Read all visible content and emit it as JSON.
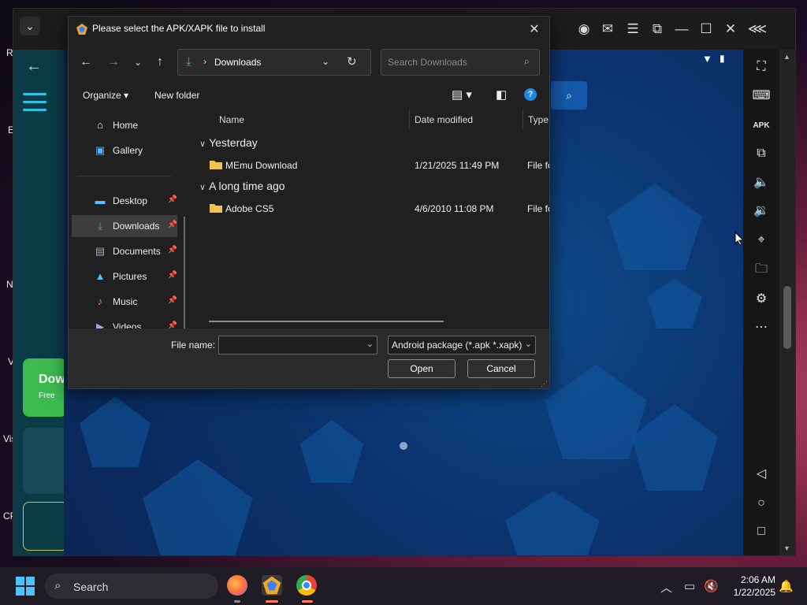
{
  "dialog": {
    "title": "Please select the APK/XAPK file to install",
    "location": "Downloads",
    "search_placeholder": "Search Downloads",
    "organize_label": "Organize",
    "new_folder_label": "New folder",
    "nav_items": [
      {
        "label": "Home",
        "pinned": false
      },
      {
        "label": "Gallery",
        "pinned": false
      },
      {
        "label": "Desktop",
        "pinned": true
      },
      {
        "label": "Downloads",
        "pinned": true,
        "selected": true
      },
      {
        "label": "Documents",
        "pinned": true
      },
      {
        "label": "Pictures",
        "pinned": true
      },
      {
        "label": "Music",
        "pinned": true
      },
      {
        "label": "Videos",
        "pinned": true
      }
    ],
    "columns": {
      "name": "Name",
      "date": "Date modified",
      "type": "Type"
    },
    "groups": [
      {
        "label": "Yesterday",
        "files": [
          {
            "name": "MEmu Download",
            "date": "1/21/2025 11:49 PM",
            "type": "File fo"
          }
        ]
      },
      {
        "label": "A long time ago",
        "files": [
          {
            "name": "Adobe CS5",
            "date": "4/6/2010 11:08 PM",
            "type": "File fo"
          }
        ]
      }
    ],
    "file_name_label": "File name:",
    "file_name_value": "",
    "file_type": "Android package (*.apk *.xapk)",
    "open_label": "Open",
    "cancel_label": "Cancel"
  },
  "emulator": {
    "tools": [
      "fullscreen-icon",
      "keyboard-icon",
      "apk-icon",
      "multi-instance-icon",
      "volume-up-icon",
      "volume-down-icon",
      "location-icon",
      "folder-icon",
      "settings-icon",
      "more-icon"
    ],
    "apk_label": "APK",
    "app_tile_title": "Dow",
    "app_tile_sub": "Free"
  },
  "taskbar": {
    "search_label": "Search",
    "time": "2:06 AM",
    "date": "1/22/2025"
  },
  "desktop_fragments": [
    "R",
    "E",
    "N",
    "V",
    "Vis",
    "CP"
  ],
  "colors": {
    "accent": "#4cc2ff",
    "downloads_icon": "#3bbf6e",
    "folder": "#f2c14e",
    "android_bg": "#0b3470"
  }
}
